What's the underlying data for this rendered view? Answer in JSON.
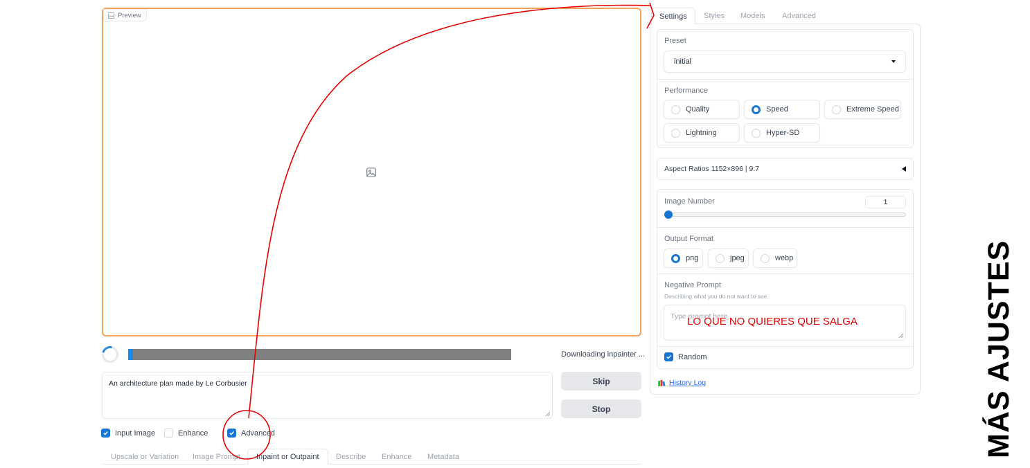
{
  "preview": {
    "label": "Preview"
  },
  "progress": {
    "percent": 1.3,
    "status_text": "Downloading inpainter ..."
  },
  "prompt": {
    "value": "An architecture plan made by Le Corbusier"
  },
  "buttons": {
    "skip": "Skip",
    "stop": "Stop"
  },
  "options": [
    {
      "label": "Input Image",
      "checked": true
    },
    {
      "label": "Enhance",
      "checked": false
    },
    {
      "label": "Advanced",
      "checked": true
    }
  ],
  "bottom_tabs": [
    "Upscale or Variation",
    "Image Prompt",
    "Inpaint or Outpaint",
    "Describe",
    "Enhance",
    "Metadata"
  ],
  "bottom_tabs_active": "Inpaint or Outpaint",
  "settings_tabs": [
    "Settings",
    "Styles",
    "Models",
    "Advanced"
  ],
  "settings": {
    "preset": {
      "label": "Preset",
      "value": "initial"
    },
    "performance": {
      "label": "Performance",
      "options": [
        "Quality",
        "Speed",
        "Extreme Speed",
        "Lightning",
        "Hyper-SD"
      ],
      "selected": "Speed"
    },
    "aspect_ratios": {
      "label": "Aspect Ratios 1152×896 | 9:7"
    },
    "image_number": {
      "label": "Image Number",
      "value": "1"
    },
    "output_format": {
      "label": "Output Format",
      "options": [
        "png",
        "jpeg",
        "webp"
      ],
      "selected": "png"
    },
    "negative_prompt": {
      "label": "Negative Prompt",
      "hint": "Describing what you do not want to see.",
      "placeholder": "Type prompt here."
    },
    "random": {
      "label": "Random",
      "checked": true
    },
    "history_log": "History Log"
  },
  "annotations": {
    "negative_note": "LO QUE NO QUIERES QUE SALGA",
    "side_title": "MÁS AJUSTES",
    "color": "#e30000"
  }
}
